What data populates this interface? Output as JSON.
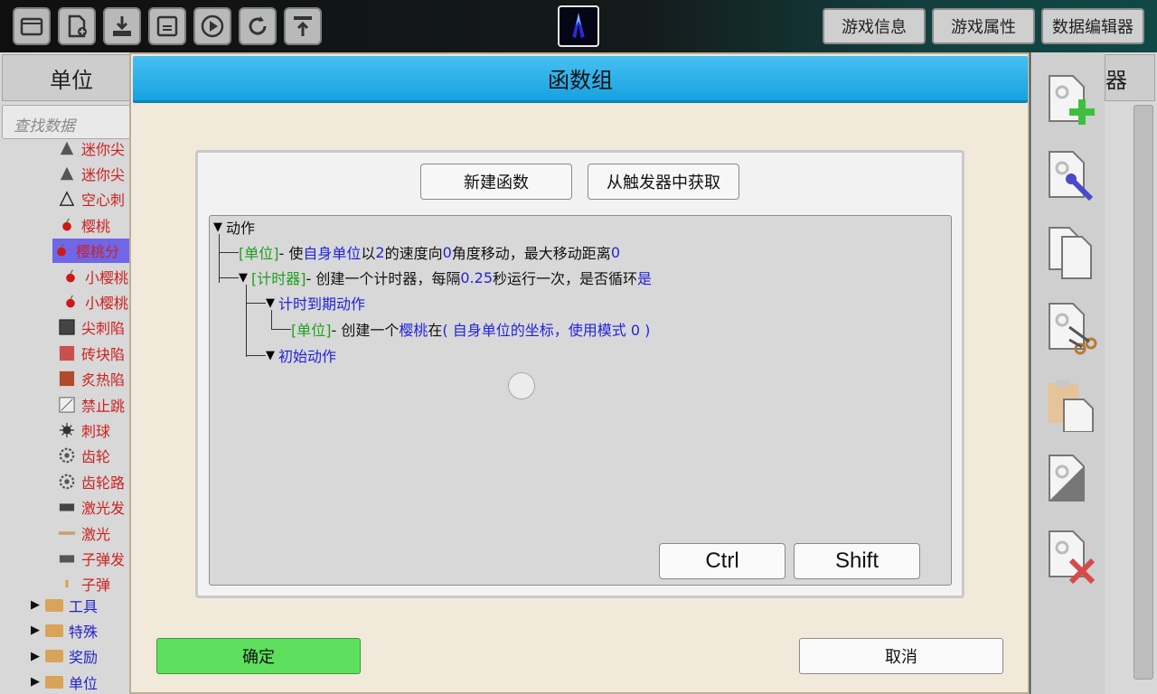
{
  "toolbar": {
    "icons": [
      "folder-open-icon",
      "new-file-icon",
      "download-icon",
      "save-icon",
      "play-icon",
      "refresh-icon",
      "upload-icon"
    ],
    "center_icon": "game-character-icon",
    "right_buttons": [
      "游戏信息",
      "游戏属性",
      "数据编辑器"
    ]
  },
  "left_panel": {
    "header": "单位",
    "search_placeholder": "查找数据",
    "items": [
      {
        "label": "迷你尖",
        "color": "#cc2222",
        "icon": "triangle-icon"
      },
      {
        "label": "迷你尖",
        "color": "#cc2222",
        "icon": "triangle-icon"
      },
      {
        "label": "空心刺",
        "color": "#cc2222",
        "icon": "triangle-outline-icon"
      },
      {
        "label": "樱桃",
        "color": "#cc2222",
        "icon": "cherry-icon"
      },
      {
        "label": "樱桃分",
        "color": "#cc2222",
        "icon": "cherry-icon",
        "selected": true
      },
      {
        "label": "小樱桃",
        "color": "#cc2222",
        "icon": "cherry-icon"
      },
      {
        "label": "小樱桃",
        "color": "#cc2222",
        "icon": "cherry-icon"
      },
      {
        "label": "尖刺陷",
        "color": "#cc2222",
        "icon": "spike-block-icon"
      },
      {
        "label": "砖块陷",
        "color": "#cc2222",
        "icon": "brick-icon"
      },
      {
        "label": "炙热陷",
        "color": "#cc2222",
        "icon": "lava-icon"
      },
      {
        "label": "禁止跳",
        "color": "#cc2222",
        "icon": "no-jump-icon"
      },
      {
        "label": "刺球",
        "color": "#cc2222",
        "icon": "spike-ball-icon"
      },
      {
        "label": "齿轮",
        "color": "#cc2222",
        "icon": "gear-icon"
      },
      {
        "label": "齿轮路",
        "color": "#cc2222",
        "icon": "gear-icon"
      },
      {
        "label": "激光发",
        "color": "#cc2222",
        "icon": "laser-emitter-icon"
      },
      {
        "label": "激光",
        "color": "#cc2222",
        "icon": "laser-icon"
      },
      {
        "label": "子弹发",
        "color": "#cc2222",
        "icon": "bullet-emitter-icon"
      },
      {
        "label": "子弹",
        "color": "#cc2222",
        "icon": "bullet-icon"
      }
    ],
    "folders": [
      {
        "label": "工具",
        "color": "#2222cc"
      },
      {
        "label": "特殊",
        "color": "#2222cc"
      },
      {
        "label": "奖励",
        "color": "#2222cc"
      },
      {
        "label": "单位",
        "color": "#2222cc"
      }
    ]
  },
  "right_panel": {
    "header_partial": "器",
    "tools": [
      "add-file-icon",
      "edit-file-icon",
      "copy-file-icon",
      "cut-file-icon",
      "paste-icon",
      "blank-file-icon",
      "delete-file-icon"
    ]
  },
  "modal": {
    "title": "函数组",
    "new_function": "新建函数",
    "from_trigger": "从触发器中获取",
    "code": {
      "root": "动作",
      "line1": {
        "tag": "[单位]",
        "t1": " - 使 ",
        "v1": "自身单位",
        "t2": " 以 ",
        "v2": "2",
        "t3": " 的速度向 ",
        "v3": "0",
        "t4": " 角度移动，最大移动距离 ",
        "v4": "0"
      },
      "line2": {
        "tag": "[计时器]",
        "t1": " - 创建一个计时器，每隔 ",
        "v1": "0.25",
        "t2": " 秒运行一次，是否循环 ",
        "v2": "是"
      },
      "line3": "计时到期动作",
      "line4": {
        "tag": "[单位]",
        "t1": " - 创建一个 ",
        "v1": "樱桃",
        "t2": " 在 ",
        "v2": "( 自身单位的坐标，使用模式 0 )"
      },
      "line5": "初始动作"
    },
    "ctrl": "Ctrl",
    "shift": "Shift",
    "ok": "确定",
    "cancel": "取消"
  }
}
